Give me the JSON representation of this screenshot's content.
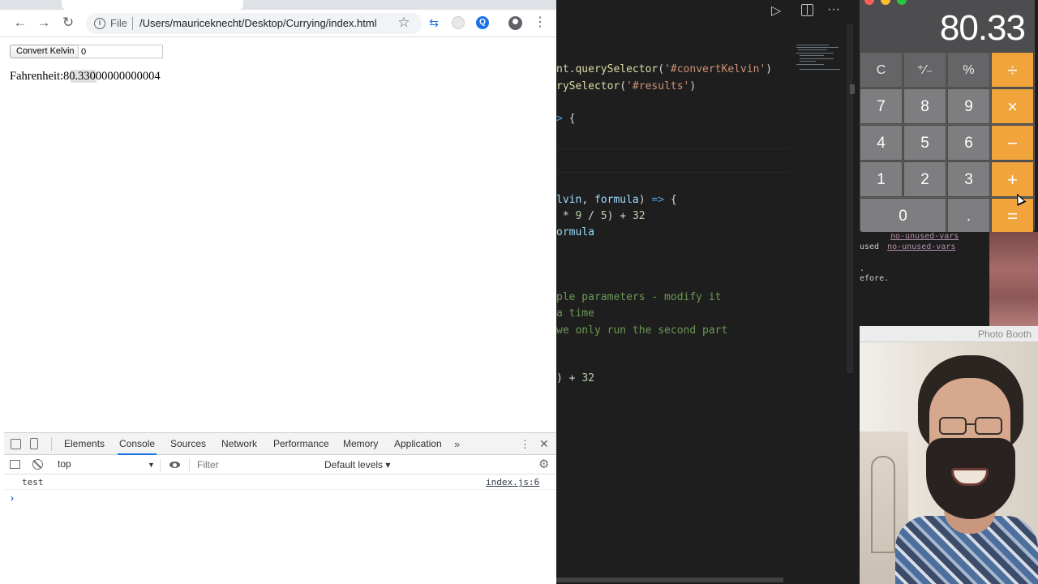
{
  "browser": {
    "nav": {
      "back_icon": "arrow-left-icon",
      "forward_icon": "arrow-right-icon",
      "reload_icon": "reload-icon",
      "back_glyph": "←",
      "forward_glyph": "→",
      "reload_glyph": "↻"
    },
    "omnibox": {
      "scheme_label": "File",
      "url": "/Users/mauriceknecht/Desktop/Currying/index.html"
    },
    "icons": {
      "star_glyph": "☆",
      "menu_glyph": "⋮",
      "ext_1_glyph": "⇆",
      "ext_3_glyph": "Q"
    },
    "page": {
      "convert_button_label": "Convert Kelvin",
      "kelvin_input_value": "0",
      "result_label": "Fahrenheit:",
      "result_value": "80.33000000000004"
    },
    "devtools": {
      "tabs": [
        "Elements",
        "Console",
        "Sources",
        "Network",
        "Performance",
        "Memory",
        "Application"
      ],
      "active_tab": "Console",
      "more_glyph": "»",
      "kebab_glyph": "⋮",
      "close_glyph": "✕",
      "context_value": "top",
      "context_arrow": "▼",
      "filter_placeholder": "Filter",
      "levels_label": "Default levels ▾",
      "gear_glyph": "⚙",
      "log_message": "test",
      "log_source": "index.js:6",
      "prompt_glyph": "›"
    }
  },
  "vscode": {
    "run_glyph": "▷",
    "more_glyph": "···",
    "code_lines": [
      {
        "tokens": [
          [
            "c-fn",
            "nt"
          ],
          [
            "c-op",
            "."
          ],
          [
            "c-fn",
            "querySelector"
          ],
          [
            "c-op",
            "("
          ],
          [
            "c-str",
            "'#convertKelvin'"
          ],
          [
            "c-op",
            ")"
          ]
        ]
      },
      {
        "tokens": [
          [
            "c-fn",
            "rySelector"
          ],
          [
            "c-op",
            "("
          ],
          [
            "c-str",
            "'#results'"
          ],
          [
            "c-op",
            ")"
          ]
        ]
      },
      {
        "tokens": [
          [
            "c-kw",
            ">"
          ],
          [
            "c-op",
            " {"
          ]
        ]
      },
      {
        "tokens": [
          [
            "c-var",
            "lvin"
          ],
          [
            "c-op",
            ", "
          ],
          [
            "c-var",
            "formula"
          ],
          [
            "c-op",
            ") "
          ],
          [
            "c-kw",
            "=>"
          ],
          [
            "c-op",
            " {"
          ]
        ]
      },
      {
        "tokens": [
          [
            "c-op",
            " * "
          ],
          [
            "c-num",
            "9"
          ],
          [
            "c-op",
            " / "
          ],
          [
            "c-num",
            "5"
          ],
          [
            "c-op",
            ") + "
          ],
          [
            "c-num",
            "32"
          ]
        ]
      },
      {
        "tokens": [
          [
            "c-var",
            "ormula"
          ]
        ]
      },
      {
        "tokens": [
          [
            "c-com",
            "ple parameters - modify it"
          ]
        ]
      },
      {
        "tokens": [
          [
            "c-com",
            "a time"
          ]
        ]
      },
      {
        "tokens": [
          [
            "c-com",
            "we only run the second part"
          ]
        ]
      },
      {
        "tokens": [
          [
            "c-op",
            ") + "
          ],
          [
            "c-num",
            "32"
          ]
        ]
      }
    ]
  },
  "calculator": {
    "display": "80.33",
    "keys": [
      {
        "label": "C",
        "kind": "fn",
        "name": "clear-key"
      },
      {
        "label": "⁺∕₋",
        "kind": "fn",
        "name": "sign-key"
      },
      {
        "label": "%",
        "kind": "fn",
        "name": "percent-key"
      },
      {
        "label": "÷",
        "kind": "op",
        "name": "divide-key"
      },
      {
        "label": "7",
        "kind": "num",
        "name": "key-7"
      },
      {
        "label": "8",
        "kind": "num",
        "name": "key-8"
      },
      {
        "label": "9",
        "kind": "num",
        "name": "key-9"
      },
      {
        "label": "×",
        "kind": "op",
        "name": "multiply-key"
      },
      {
        "label": "4",
        "kind": "num",
        "name": "key-4"
      },
      {
        "label": "5",
        "kind": "num",
        "name": "key-5"
      },
      {
        "label": "6",
        "kind": "num",
        "name": "key-6"
      },
      {
        "label": "−",
        "kind": "op",
        "name": "minus-key"
      },
      {
        "label": "1",
        "kind": "num",
        "name": "key-1"
      },
      {
        "label": "2",
        "kind": "num",
        "name": "key-2"
      },
      {
        "label": "3",
        "kind": "num",
        "name": "key-3"
      },
      {
        "label": "+",
        "kind": "op",
        "name": "plus-key"
      },
      {
        "label": "0",
        "kind": "num",
        "name": "key-0"
      },
      {
        "label": ".",
        "kind": "num",
        "name": "decimal-key"
      },
      {
        "label": "=",
        "kind": "op",
        "name": "equals-key"
      }
    ],
    "colors": {
      "operator": "#f1a33c",
      "number": "#7e7d80",
      "function": "#656467"
    }
  },
  "terminal": {
    "lines": [
      {
        "prefix": "",
        "link": "no-unused-vars"
      },
      {
        "prefix": "used",
        "link": "no-unused-vars"
      },
      {
        "prefix": ".",
        "link": ""
      },
      {
        "prefix": "efore.",
        "link": ""
      }
    ]
  },
  "photobooth": {
    "title": "Photo Booth"
  }
}
